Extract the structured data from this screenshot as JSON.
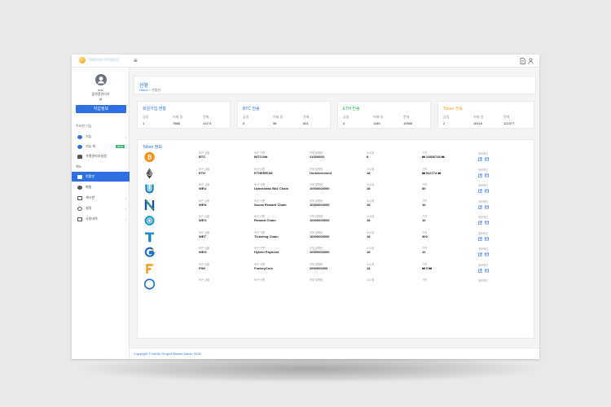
{
  "app": {
    "brand": "NetSe Project"
  },
  "sidebar": {
    "user_name": "test",
    "user_role": "플랫폼관리자",
    "user_extra": "@",
    "profile_button": "지갑정보",
    "section_main": "주요한 기능",
    "section_menu": "메뉴",
    "items": [
      {
        "label": "기능",
        "icon": "palette-icon"
      },
      {
        "label": "기능 비",
        "icon": "palette-icon",
        "badge": "NEW"
      },
      {
        "label": "가맹관리자설정",
        "icon": "users-icon"
      },
      {
        "label": "현황판",
        "icon": "dashboard-icon",
        "active": true
      },
      {
        "label": "회원",
        "icon": "group-icon"
      },
      {
        "label": "게시판",
        "icon": "chat-icon"
      },
      {
        "label": "설정",
        "icon": "gear-icon"
      },
      {
        "label": "사용내역",
        "icon": "file-icon"
      }
    ]
  },
  "header": {
    "title": "현황",
    "breadcrumb_home": "Home",
    "breadcrumb_sep": ">",
    "breadcrumb_current": "현황판"
  },
  "stats": [
    {
      "title": "회원가입 현황",
      "color": "#2f6fe4",
      "headers": [
        "금일",
        "어제 일",
        "전체"
      ],
      "values": [
        "1",
        "7866",
        "41171"
      ]
    },
    {
      "title": "BTC 전송",
      "color": "#2f6fe4",
      "headers": [
        "금일",
        "어제 일",
        "전체"
      ],
      "values": [
        "0",
        "56",
        "601"
      ]
    },
    {
      "title": "ETH 전송",
      "color": "#2aa84a",
      "headers": [
        "금일",
        "어제 일",
        "전체"
      ],
      "values": [
        "4",
        "1180",
        "10565"
      ]
    },
    {
      "title": "Token 전송",
      "color": "#f5a623",
      "headers": [
        "금일",
        "어제 일",
        "전체"
      ],
      "values": [
        "2",
        "16118",
        "121977"
      ]
    }
  ],
  "token_section": {
    "title": "Token 정보"
  },
  "token_headers": {
    "symbol": "토큰 심볼",
    "name": "토큰 이름",
    "supply": "전체 발행량",
    "decimals": "소수점",
    "price": "가격",
    "detail": "정보확인"
  },
  "tokens": [
    {
      "symbol": "BTC",
      "name": "BITCOIN",
      "supply": "21000000",
      "decimals": "8",
      "price": "₩ 13836748 ₩",
      "icon": "bitcoin-icon"
    },
    {
      "symbol": "ETH",
      "name": "ETHEREUM",
      "supply": "Undetermined",
      "decimals": "18",
      "price": "₩ 512774 ₩",
      "icon": "ethereum-icon"
    },
    {
      "symbol": "WEU",
      "name": "Uzbekistan Bit2 Chain",
      "supply": "10000000000",
      "decimals": "18",
      "price": "80",
      "icon": "weu-icon"
    },
    {
      "symbol": "WEN",
      "name": "Social Reward Chain",
      "supply": "10000000000",
      "decimals": "18",
      "price": "10",
      "icon": "wen-icon"
    },
    {
      "symbol": "WEO",
      "name": "Reward Chain",
      "supply": "10000000000",
      "decimals": "18",
      "price": "10",
      "icon": "weo-icon"
    },
    {
      "symbol": "WET",
      "name": "Ticketing Chain",
      "supply": "10000000000",
      "decimals": "18",
      "price": "300",
      "icon": "wet-icon"
    },
    {
      "symbol": "WEG",
      "name": "Hybrid Payment",
      "supply": "10000000000",
      "decimals": "18",
      "price": "10",
      "icon": "weg-icon"
    },
    {
      "symbol": "FNK",
      "name": "FunkeyCoin",
      "supply": "2000000000",
      "decimals": "18",
      "price": "₩ 0 ₩",
      "icon": "fnk-icon"
    },
    {
      "symbol": "",
      "name": "",
      "supply": "",
      "decimals": "",
      "price": "",
      "icon": "token-icon"
    }
  ],
  "footer": {
    "text": "Copyright © NetSe Project Master Admin 2018"
  }
}
